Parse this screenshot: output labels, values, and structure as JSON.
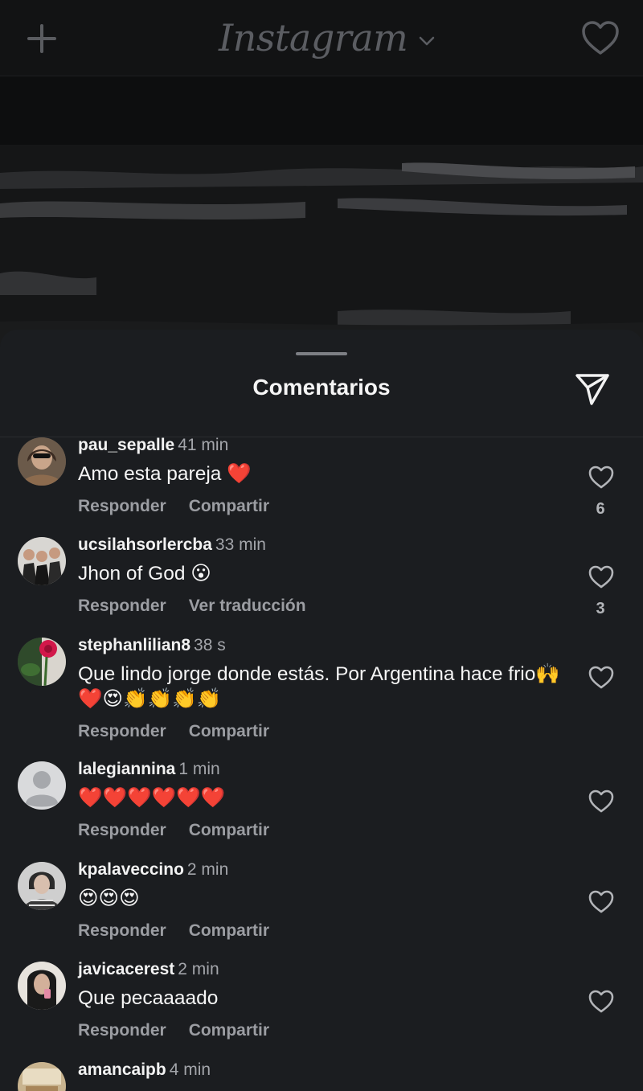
{
  "app": {
    "title": "Instagram",
    "colors": {
      "background": "#1b1d20",
      "topbar": "#121314",
      "muted": "#9b9da2",
      "heart": "#e9282f"
    }
  },
  "sheet": {
    "title": "Comentarios"
  },
  "comments": [
    {
      "user": "pau_sepalle",
      "time": "41 min",
      "text": "Amo esta pareja ❤️",
      "actions": [
        "Responder",
        "Compartir"
      ],
      "likes": "6"
    },
    {
      "user": "ucsilahsorlercba",
      "time": "33 min",
      "text": "Jhon of God 😮",
      "actions": [
        "Responder",
        "Ver traducción"
      ],
      "likes": "3"
    },
    {
      "user": "stephanlilian8",
      "time": "38 s",
      "text": "Que lindo jorge donde estás. Por Argentina  hace frio🙌❤️😍👏👏👏👏",
      "actions": [
        "Responder",
        "Compartir"
      ],
      "likes": ""
    },
    {
      "user": "lalegiannina",
      "time": "1 min",
      "text": "❤️❤️❤️❤️❤️❤️",
      "actions": [
        "Responder",
        "Compartir"
      ],
      "likes": ""
    },
    {
      "user": "kpalaveccino",
      "time": "2 min",
      "text": "😍😍😍",
      "actions": [
        "Responder",
        "Compartir"
      ],
      "likes": ""
    },
    {
      "user": "javicacerest",
      "time": "2 min",
      "text": "Que pecaaaado",
      "actions": [
        "Responder",
        "Compartir"
      ],
      "likes": ""
    },
    {
      "user": "amancaipb",
      "time": "4 min",
      "text": "",
      "actions": [],
      "likes": ""
    }
  ],
  "icons": [
    "plus-icon",
    "chevron-down-icon",
    "heart-icon",
    "send-icon",
    "like-heart-icon"
  ]
}
